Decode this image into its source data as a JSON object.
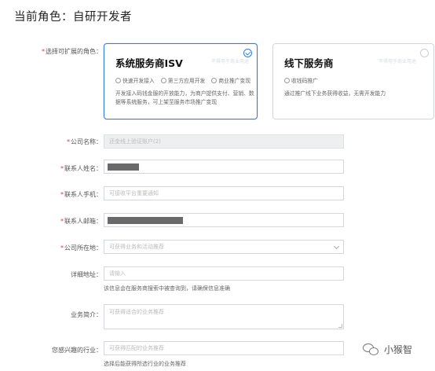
{
  "page": {
    "title": "当前角色：自研开发者"
  },
  "role_field": {
    "label": "选择可扩展的角色：",
    "options": [
      {
        "title": "系统服务商ISV",
        "features": [
          "快速开发接入",
          "第三方应用开发",
          "商业推广变现"
        ],
        "description": "开发接入码钱金服的开放能力，为商户提供支付、营销、数据等系统服务，可上架至服务市场推广变现",
        "watermark": "不得用于商业用途",
        "selected": true
      },
      {
        "title": "线下服务商",
        "features": [
          "收钱码推广"
        ],
        "description": "通过推广线下业务获得收益，无需开发能力",
        "watermark": "不得用于商业用途",
        "selected": false
      }
    ]
  },
  "form": {
    "company_name": {
      "label": "公司名称：",
      "value": "还金线上验证账户(2)"
    },
    "contact_name": {
      "label": "联系人姓名："
    },
    "contact_phone": {
      "label": "联系人手机：",
      "placeholder": "可接收平台重要通知"
    },
    "contact_email": {
      "label": "联系人邮箱："
    },
    "company_location": {
      "label": "公司所在地：",
      "placeholder": "可获得业务和活动推荐"
    },
    "address": {
      "label": "详细地址：",
      "placeholder": "请输入",
      "hint": "该信息会在服务商搜索中被查询到，请确保信息准确"
    },
    "business_intro": {
      "label": "业务简介：",
      "placeholder": "可获得适合的业务推荐"
    },
    "interested_industry": {
      "label": "您感兴趣的行业：",
      "placeholder": "可获得匹配的业务推荐",
      "hint": "选择后能获得所选行业的业务推荐"
    }
  },
  "watermark_logo": {
    "text": "小猴智"
  }
}
